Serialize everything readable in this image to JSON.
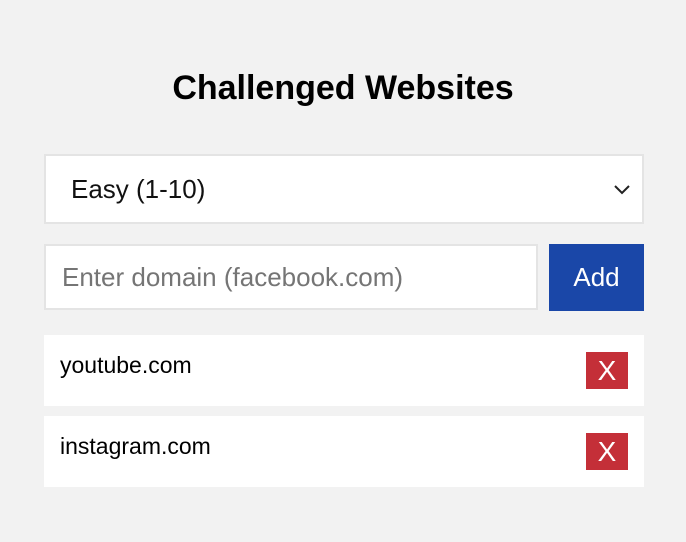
{
  "page": {
    "title": "Challenged Websites"
  },
  "difficulty": {
    "selected": "Easy (1-10)",
    "icon": "chevron-down-icon"
  },
  "domain_input": {
    "value": "",
    "placeholder": "Enter domain (facebook.com)"
  },
  "add_button": {
    "label": "Add",
    "color": "#1a47a8"
  },
  "sites": [
    {
      "domain": "youtube.com",
      "remove_label": "X"
    },
    {
      "domain": "instagram.com",
      "remove_label": "X"
    }
  ],
  "colors": {
    "background": "#f2f2f2",
    "remove": "#c42f38"
  }
}
